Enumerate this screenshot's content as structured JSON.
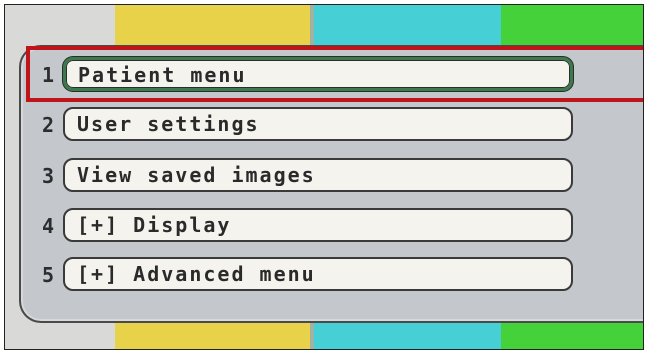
{
  "color_bars": [
    "#d9d9d7",
    "#e8d24a",
    "#9fb2a5",
    "#47cfd6",
    "#45d13a"
  ],
  "colors": {
    "panel": "#c4c7cc",
    "item_fill": "#f5f3ee",
    "selected_border": "#3a7a4c",
    "highlight": "#c0141b"
  },
  "menu": {
    "selected_index": 0,
    "items": [
      {
        "number": "1",
        "label": "Patient menu"
      },
      {
        "number": "2",
        "label": "User settings"
      },
      {
        "number": "3",
        "label": "View saved images"
      },
      {
        "number": "4",
        "label": "[+] Display"
      },
      {
        "number": "5",
        "label": "[+] Advanced menu"
      }
    ]
  }
}
